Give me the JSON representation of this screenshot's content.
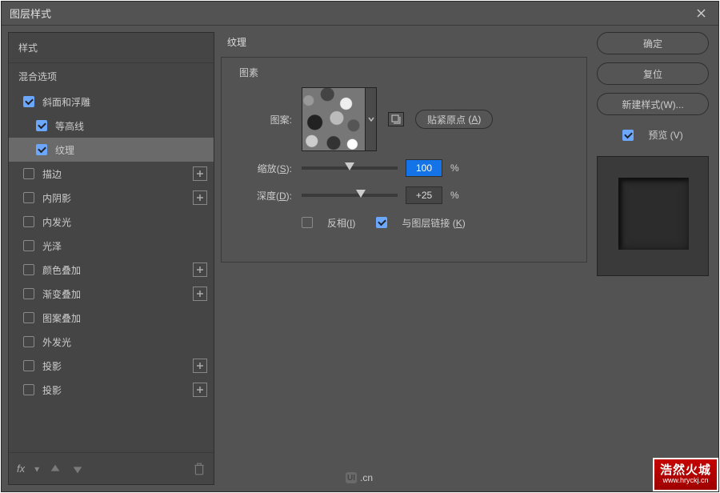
{
  "dialog": {
    "title": "图层样式"
  },
  "sidebar": {
    "header1": "样式",
    "header2": "混合选项",
    "items": [
      {
        "label": "斜面和浮雕",
        "checked": true,
        "sub": false,
        "plus": false,
        "sel": false
      },
      {
        "label": "等高线",
        "checked": true,
        "sub": true,
        "plus": false,
        "sel": false
      },
      {
        "label": "纹理",
        "checked": true,
        "sub": true,
        "plus": false,
        "sel": true
      },
      {
        "label": "描边",
        "checked": false,
        "sub": false,
        "plus": true,
        "sel": false
      },
      {
        "label": "内阴影",
        "checked": false,
        "sub": false,
        "plus": true,
        "sel": false
      },
      {
        "label": "内发光",
        "checked": false,
        "sub": false,
        "plus": false,
        "sel": false
      },
      {
        "label": "光泽",
        "checked": false,
        "sub": false,
        "plus": false,
        "sel": false
      },
      {
        "label": "颜色叠加",
        "checked": false,
        "sub": false,
        "plus": true,
        "sel": false
      },
      {
        "label": "渐变叠加",
        "checked": false,
        "sub": false,
        "plus": true,
        "sel": false
      },
      {
        "label": "图案叠加",
        "checked": false,
        "sub": false,
        "plus": false,
        "sel": false
      },
      {
        "label": "外发光",
        "checked": false,
        "sub": false,
        "plus": false,
        "sel": false
      },
      {
        "label": "投影",
        "checked": false,
        "sub": false,
        "plus": true,
        "sel": false
      },
      {
        "label": "投影",
        "checked": false,
        "sub": false,
        "plus": true,
        "sel": false
      }
    ],
    "fx_label": "fx"
  },
  "main": {
    "section_title": "纹理",
    "subsection_title": "图素",
    "pattern_label": "图案:",
    "snap_label": "贴紧原点",
    "snap_key": "A",
    "scale": {
      "label": "缩放",
      "key": "S",
      "value": "100",
      "unit": "%",
      "pos": 50
    },
    "depth": {
      "label": "深度",
      "key": "D",
      "value": "+25",
      "unit": "%",
      "pos": 62
    },
    "invert": {
      "label": "反相",
      "key": "I",
      "checked": false
    },
    "link": {
      "label": "与图层链接",
      "key": "K",
      "checked": true
    }
  },
  "buttons": {
    "ok": "确定",
    "reset": "复位",
    "newstyle": "新建样式",
    "newstyle_key": "W",
    "preview": "预览",
    "preview_key": "V"
  },
  "watermark": {
    "ui": "UI",
    "cn": ".cn",
    "brand": "浩然火城",
    "url": "www.hryckj.cn"
  }
}
